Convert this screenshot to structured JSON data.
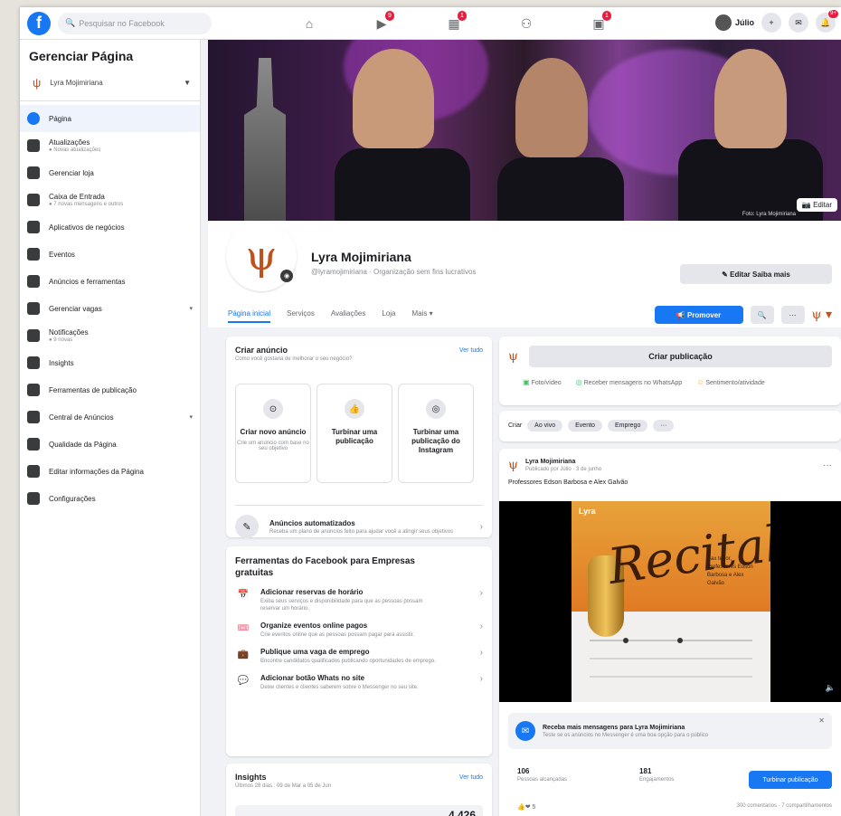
{
  "topbar": {
    "search_placeholder": "Pesquisar no Facebook",
    "user_name": "Júlio",
    "badges": {
      "watch": "9",
      "marketplace": "1",
      "groups": "1",
      "notifications": "9+"
    }
  },
  "sidebar": {
    "title": "Gerenciar Página",
    "page_name": "Lyra Mojimiriana",
    "items": [
      {
        "label": "Página",
        "sub": "",
        "icon": "flag-icon",
        "active": true
      },
      {
        "label": "Atualizações",
        "sub": "● Novas atualizações",
        "icon": "notification-icon"
      },
      {
        "label": "Gerenciar loja",
        "sub": "",
        "icon": "shop-icon"
      },
      {
        "label": "Caixa de Entrada",
        "sub": "● 7 novas mensagens e outros",
        "icon": "inbox-icon"
      },
      {
        "label": "Aplicativos de negócios",
        "sub": "",
        "icon": "apps-icon"
      },
      {
        "label": "Eventos",
        "sub": "",
        "icon": "calendar-icon"
      },
      {
        "label": "Anúncios e ferramentas",
        "sub": "",
        "icon": "megaphone-icon"
      },
      {
        "label": "Gerenciar vagas",
        "sub": "",
        "icon": "briefcase-icon",
        "chevron": true
      },
      {
        "label": "Notificações",
        "sub": "● 9 novas",
        "icon": "bell-icon"
      },
      {
        "label": "Insights",
        "sub": "",
        "icon": "chart-icon"
      },
      {
        "label": "Ferramentas de publicação",
        "sub": "",
        "icon": "tools-icon"
      },
      {
        "label": "Central de Anúncios",
        "sub": "",
        "icon": "ads-icon",
        "chevron": true
      },
      {
        "label": "Qualidade da Página",
        "sub": "",
        "icon": "quality-icon"
      },
      {
        "label": "Editar informações da Página",
        "sub": "",
        "icon": "edit-icon"
      },
      {
        "label": "Configurações",
        "sub": "",
        "icon": "settings-icon"
      }
    ]
  },
  "cover": {
    "edit_label": "Editar",
    "credit": "Foto: Lyra Mojimiriana"
  },
  "profile": {
    "name": "Lyra Mojimiriana",
    "desc": "@lyramojimiriana · Organização sem fins lucrativos",
    "edit_info": "Editar Saiba mais",
    "tabs": [
      "Página inicial",
      "Serviços",
      "Avaliações",
      "Loja",
      "Mais ▾"
    ],
    "promote": "Promover"
  },
  "create_ad": {
    "title": "Criar anúncio",
    "subtitle": "Como você gostaria de melhorar o seu negócio?",
    "link": "Ver tudo",
    "options": [
      {
        "label": "Criar novo anúncio",
        "sub": "Crie um anúncio com base no seu objetivo",
        "icon": "target-icon"
      },
      {
        "label": "Turbinar uma publicação",
        "sub": "",
        "icon": "thumbs-up-icon"
      },
      {
        "label": "Turbinar uma publicação do Instagram",
        "sub": "",
        "icon": "instagram-icon"
      }
    ],
    "auto_title": "Anúncios automatizados",
    "auto_sub": "Receba um plano de anúncios feito para ajudar você a atingir seus objetivos"
  },
  "tools": {
    "title": "Ferramentas do Facebook para Empresas gratuitas",
    "items": [
      {
        "label": "Adicionar reservas de horário",
        "sub": "Exiba seus serviços e disponibilidade para que as pessoas possam reservar um horário.",
        "icon": "calendar-icon"
      },
      {
        "label": "Organize eventos online pagos",
        "sub": "Crie eventos online que as pessoas possam pagar para assistir.",
        "icon": "ticket-icon"
      },
      {
        "label": "Publique uma vaga de emprego",
        "sub": "Encontre candidatos qualificados publicando oportunidades de emprego.",
        "icon": "briefcase-icon"
      },
      {
        "label": "Adicionar botão Whats no site",
        "sub": "Deixe clientes e clientes saberem sobre o Messenger no seu site.",
        "icon": "messenger-icon"
      }
    ]
  },
  "insights": {
    "title": "Insights",
    "sub": "Últimos 28 dias : 09 de Mar a 05 de Jun",
    "link": "Ver tudo",
    "value": "4.426"
  },
  "composer": {
    "create_label": "Criar publicação",
    "options": [
      "Foto/vídeo",
      "Receber mensagens no WhatsApp",
      "Sentimento/atividade"
    ],
    "create_row_label": "Criar",
    "chips": [
      "Ao vivo",
      "Evento",
      "Emprego",
      "···"
    ]
  },
  "post": {
    "author": "Lyra Mojimiriana",
    "meta": "Publicado por Júlio · 3 de junho",
    "text": "Professores Edson Barbosa e Alex Galvão",
    "poster_brand": "Lyra",
    "poster_title": "Recital",
    "poster_details": "Sax tenor, Professores Edson Barbosa e Alex Galvão",
    "message_title": "Receba mais mensagens para Lyra Mojimiriana",
    "message_sub": "Teste se os anúncios no Messenger é uma boa opção para o público",
    "stat1_n": "106",
    "stat1_l": "Pessoas alcançadas",
    "stat2_n": "181",
    "stat2_l": "Engajamentos",
    "boost": "Turbinar publicação",
    "reactions": "5",
    "comments": "300 comentários · 7 compartilhamentos"
  }
}
